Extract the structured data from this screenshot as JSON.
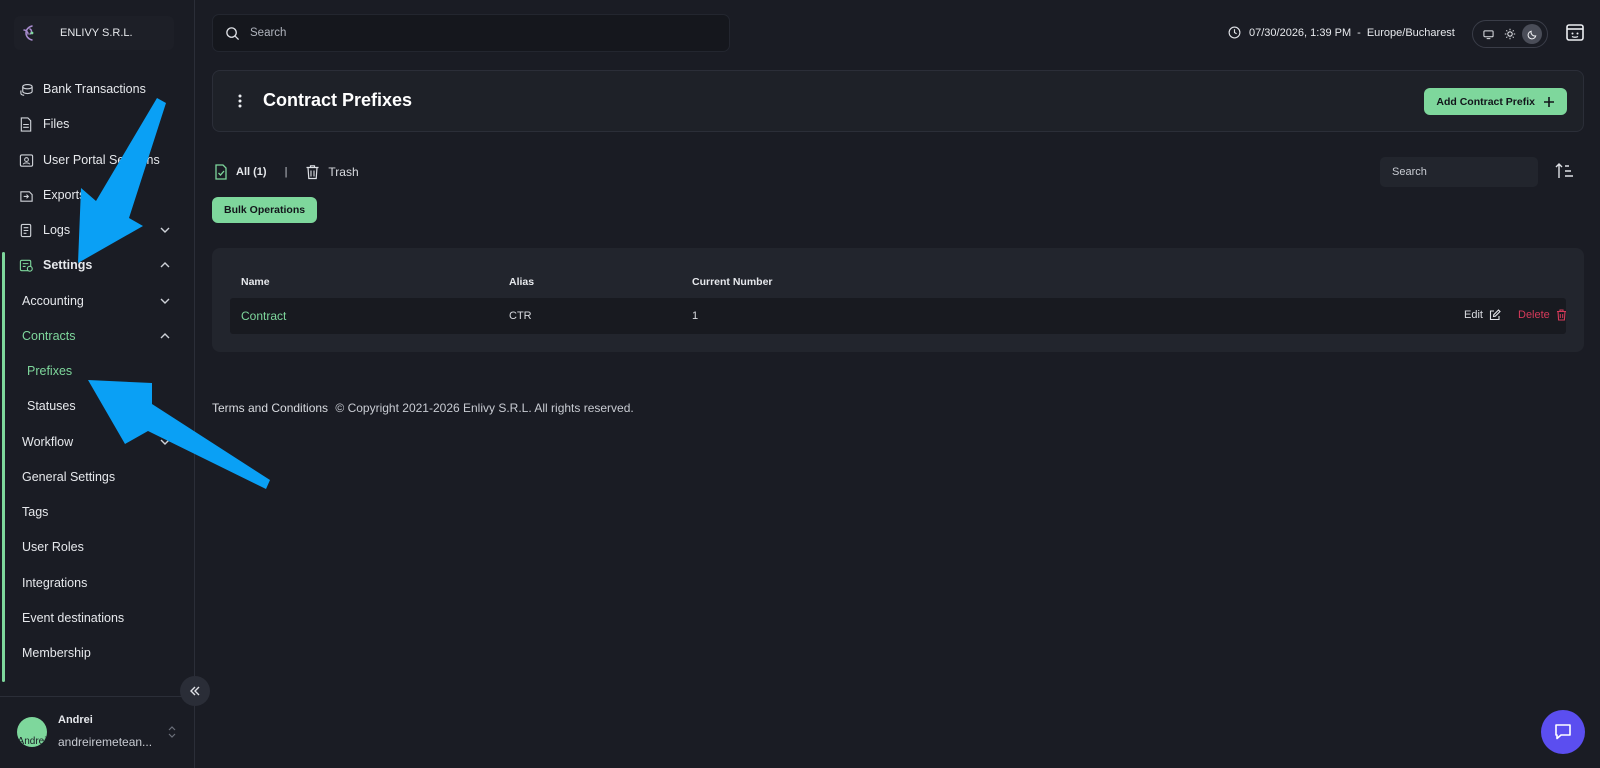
{
  "sidebar": {
    "org_name": "ENLIVY S.R.L.",
    "items": [
      {
        "label": "Bank Transactions",
        "icon": "coin-stack-icon"
      },
      {
        "label": "Files",
        "icon": "file-icon"
      },
      {
        "label": "User Portal Sessions",
        "icon": "user-session-icon"
      },
      {
        "label": "Exports",
        "icon": "export-icon"
      },
      {
        "label": "Logs",
        "icon": "logs-icon"
      },
      {
        "label": "Settings",
        "icon": "settings-icon"
      }
    ],
    "settings_children": [
      {
        "label": "Accounting"
      },
      {
        "label": "Contracts"
      },
      {
        "label": "Prefixes"
      },
      {
        "label": "Statuses"
      },
      {
        "label": "Workflow"
      },
      {
        "label": "General Settings"
      },
      {
        "label": "Tags"
      },
      {
        "label": "User Roles"
      },
      {
        "label": "Integrations"
      },
      {
        "label": "Event destinations"
      },
      {
        "label": "Membership"
      }
    ],
    "user": {
      "name": "Andrei",
      "email": "andreiremetean...",
      "avatar_text": "Andrei"
    }
  },
  "topbar": {
    "search_placeholder": "Search",
    "datetime": "07/30/2026, 1:39 PM",
    "separator": "-",
    "timezone": "Europe/Bucharest"
  },
  "header": {
    "title": "Contract Prefixes",
    "add_button_label": "Add Contract Prefix"
  },
  "filters": {
    "all_label": "All (1)",
    "separator": "|",
    "trash_label": "Trash",
    "search_placeholder": "Search",
    "bulk_label": "Bulk Operations"
  },
  "table": {
    "columns": [
      "Name",
      "Alias",
      "Current Number"
    ],
    "rows": [
      {
        "name": "Contract",
        "alias": "CTR",
        "current_number": "1",
        "edit": "Edit",
        "delete": "Delete"
      }
    ]
  },
  "footer": {
    "terms": "Terms and Conditions",
    "copyright": "© Copyright 2021-2026 Enlivy S.R.L. All rights reserved."
  },
  "colors": {
    "accent": "#7ed79c",
    "danger": "#d63a5a",
    "chat": "#5b4ef0",
    "annotation_arrow": "#0aa0f5"
  }
}
